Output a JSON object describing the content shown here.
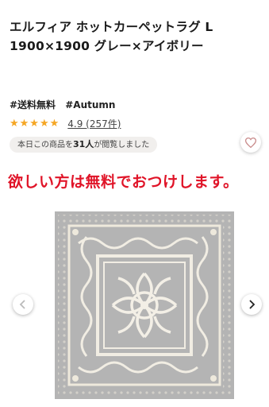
{
  "product": {
    "title": "エルフィア ホットカーペットラグ L 1900×1900 グレー×アイボリー",
    "tags": [
      "#送料無料",
      "#Autumn"
    ],
    "rating": {
      "value": "4.9",
      "count_text": "4.9 (257件)",
      "stars": 5
    },
    "views_prefix": "本日この商品を",
    "views_count": "31人",
    "views_suffix": "が閲覧しました"
  },
  "banner_text": "欲しい方は無料でおつけします。",
  "icons": {
    "favorite": "heart-icon",
    "prev": "chevron-left-icon",
    "next": "chevron-right-icon"
  },
  "colors": {
    "accent_red": "#e01428",
    "star": "#f5a623",
    "rug_gray": "#b6b6b6",
    "rug_ivory": "#f1ede3"
  }
}
